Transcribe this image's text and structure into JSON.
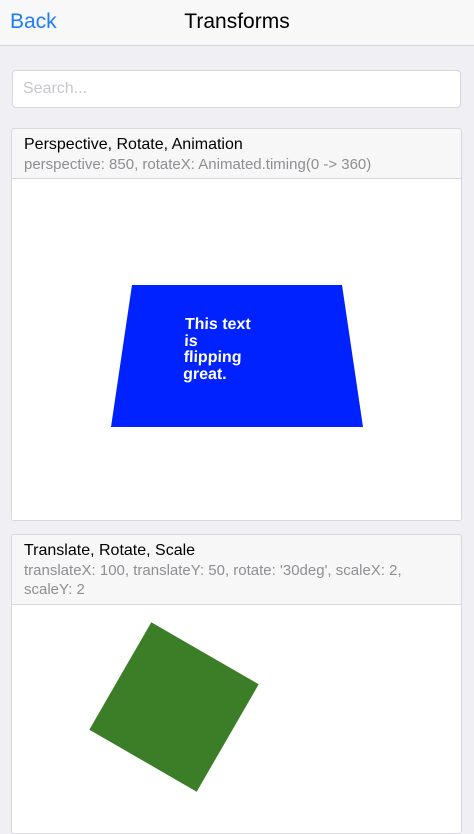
{
  "navbar": {
    "back_label": "Back",
    "title": "Transforms"
  },
  "search": {
    "placeholder": "Search...",
    "value": ""
  },
  "examples": [
    {
      "title": "Perspective, Rotate, Animation",
      "description": "perspective: 850, rotateX: Animated.timing(0 -> 360)",
      "text_lines": [
        "This text",
        "is",
        "flipping",
        "great."
      ],
      "color": "#0022ff"
    },
    {
      "title": "Translate, Rotate, Scale",
      "description": "translateX: 100, translateY: 50, rotate: '30deg', scaleX: 2, scaleY: 2",
      "color": "#3b7e27"
    }
  ],
  "colors": {
    "accent": "#1f7bf7",
    "background": "#efeff4"
  }
}
